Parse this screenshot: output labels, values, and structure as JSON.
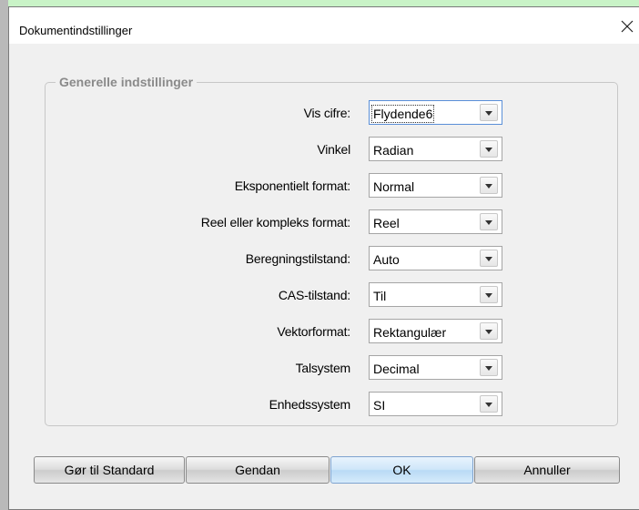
{
  "dialog": {
    "title": "Dokumentindstillinger",
    "close_icon": "close-icon"
  },
  "group": {
    "title": "Generelle indstillinger"
  },
  "settings": [
    {
      "label": "Vis cifre:",
      "value": "Flydende6"
    },
    {
      "label": "Vinkel",
      "value": "Radian"
    },
    {
      "label": "Eksponentielt format:",
      "value": "Normal"
    },
    {
      "label": "Reel eller kompleks format:",
      "value": "Reel"
    },
    {
      "label": "Beregningstilstand:",
      "value": "Auto"
    },
    {
      "label": "CAS-tilstand:",
      "value": "Til"
    },
    {
      "label": "Vektorformat:",
      "value": "Rektangulær"
    },
    {
      "label": "Talsystem",
      "value": "Decimal"
    },
    {
      "label": "Enhedssystem",
      "value": "SI"
    }
  ],
  "buttons": {
    "default_label": "Gør til Standard",
    "restore_label": "Gendan",
    "ok_label": "OK",
    "cancel_label": "Annuller"
  }
}
